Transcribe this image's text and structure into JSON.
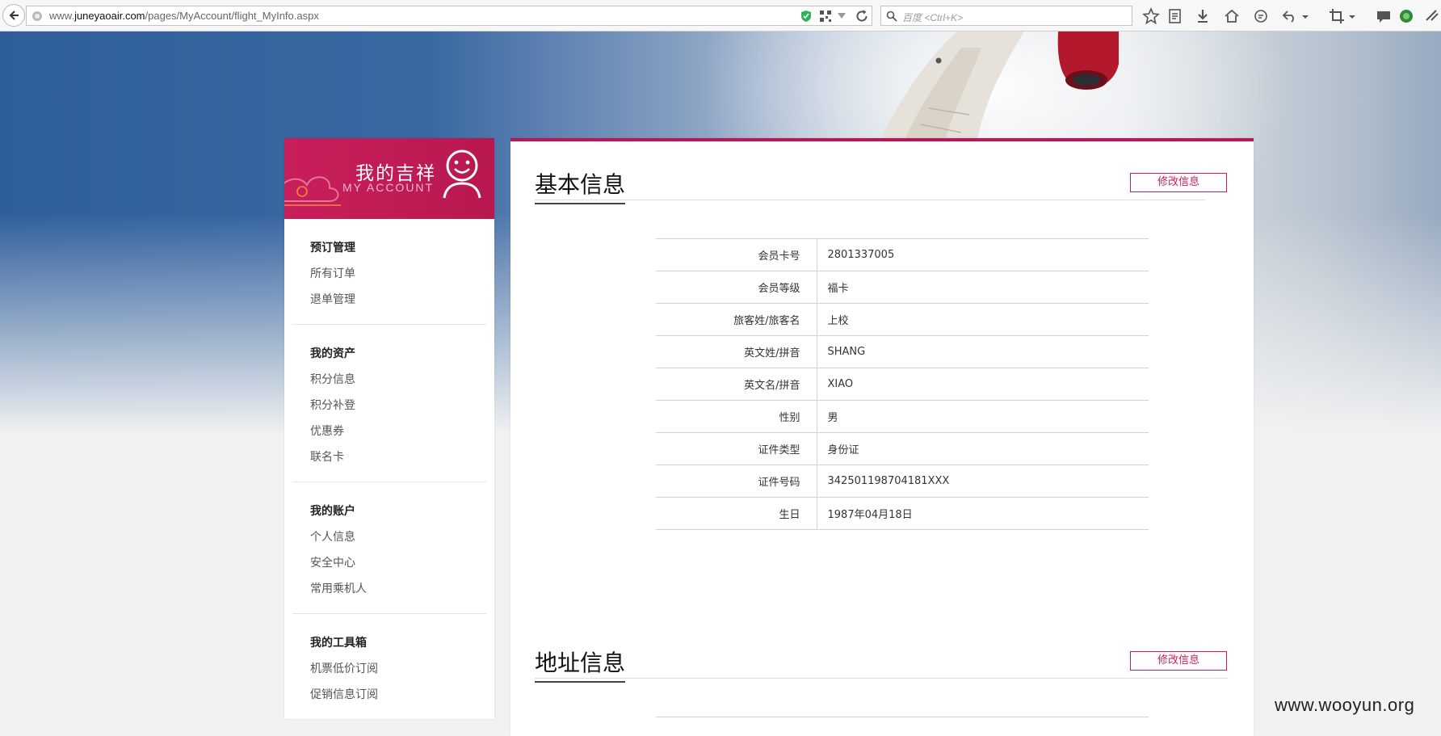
{
  "browser": {
    "url_prefix": "www.",
    "url_domain": "juneyaoair.com",
    "url_path": "/pages/MyAccount/flight_MyInfo.aspx",
    "search_placeholder": "百度 <Ctrl+K>"
  },
  "sidebar": {
    "header_cn": "我的吉祥",
    "header_en": "MY ACCOUNT",
    "groups": [
      {
        "title": "预订管理",
        "items": [
          "所有订单",
          "退单管理"
        ]
      },
      {
        "title": "我的资产",
        "items": [
          "积分信息",
          "积分补登",
          "优惠券",
          "联名卡"
        ]
      },
      {
        "title": "我的账户",
        "items": [
          "个人信息",
          "安全中心",
          "常用乘机人"
        ]
      },
      {
        "title": "我的工具箱",
        "items": [
          "机票低价订阅",
          "促销信息订阅"
        ]
      }
    ]
  },
  "basic_info": {
    "title": "基本信息",
    "edit_label": "修改信息",
    "rows": [
      {
        "label": "会员卡号",
        "value": "2801337005"
      },
      {
        "label": "会员等级",
        "value": "福卡"
      },
      {
        "label": "旅客姓/旅客名",
        "value": "上校"
      },
      {
        "label": "英文姓/拼音",
        "value": "SHANG"
      },
      {
        "label": "英文名/拼音",
        "value": "XIAO"
      },
      {
        "label": "性别",
        "value": "男"
      },
      {
        "label": "证件类型",
        "value": "身份证"
      },
      {
        "label": "证件号码",
        "value": "342501198704181XXX"
      },
      {
        "label": "生日",
        "value": "1987年04月18日"
      }
    ]
  },
  "address_info": {
    "title": "地址信息",
    "edit_label": "修改信息"
  },
  "watermark": "www.wooyun.org",
  "colors": {
    "brand": "#c81f5b",
    "hero_blue": "#2f5f9b"
  }
}
